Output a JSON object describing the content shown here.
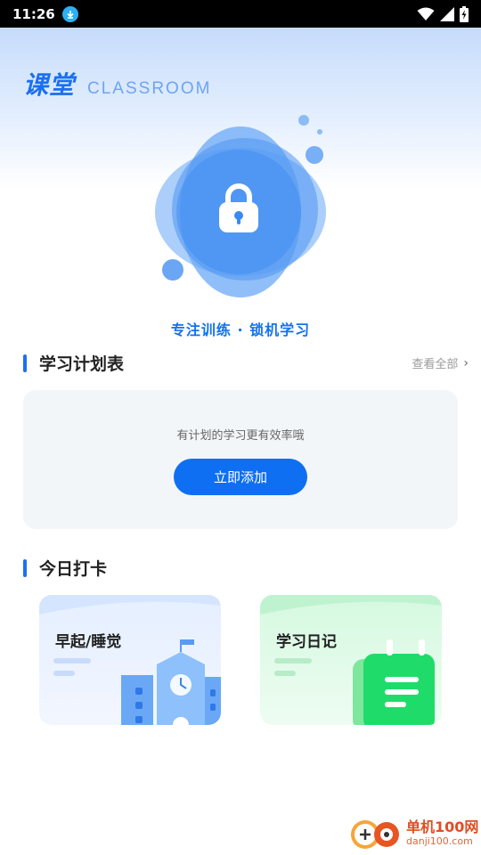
{
  "status_bar": {
    "time": "11:26",
    "icons": [
      "download-icon",
      "wifi-icon",
      "signal-icon",
      "battery-charging-icon"
    ]
  },
  "header": {
    "title_cn": "课堂",
    "title_en": "CLASSROOM"
  },
  "hero": {
    "icon": "lock-icon",
    "tagline": "专注训练 · 锁机学习"
  },
  "plan_section": {
    "title": "学习计划表",
    "view_all": "查看全部",
    "empty_hint": "有计划的学习更有效率哦",
    "add_button": "立即添加"
  },
  "checkin_section": {
    "title": "今日打卡",
    "cards": [
      {
        "label": "早起/睡觉",
        "icon": "school-clock-icon"
      },
      {
        "label": "学习日记",
        "icon": "notepad-icon"
      }
    ]
  },
  "watermark": {
    "cn": "单机100网",
    "en": "danji100.com"
  },
  "colors": {
    "accent": "#0f6ff2",
    "section_bar": "#1d6ff2",
    "plan_card_bg": "#f3f6f9",
    "wake_card_bg": "#e5efff",
    "diary_card_bg": "#d5f9e0"
  }
}
